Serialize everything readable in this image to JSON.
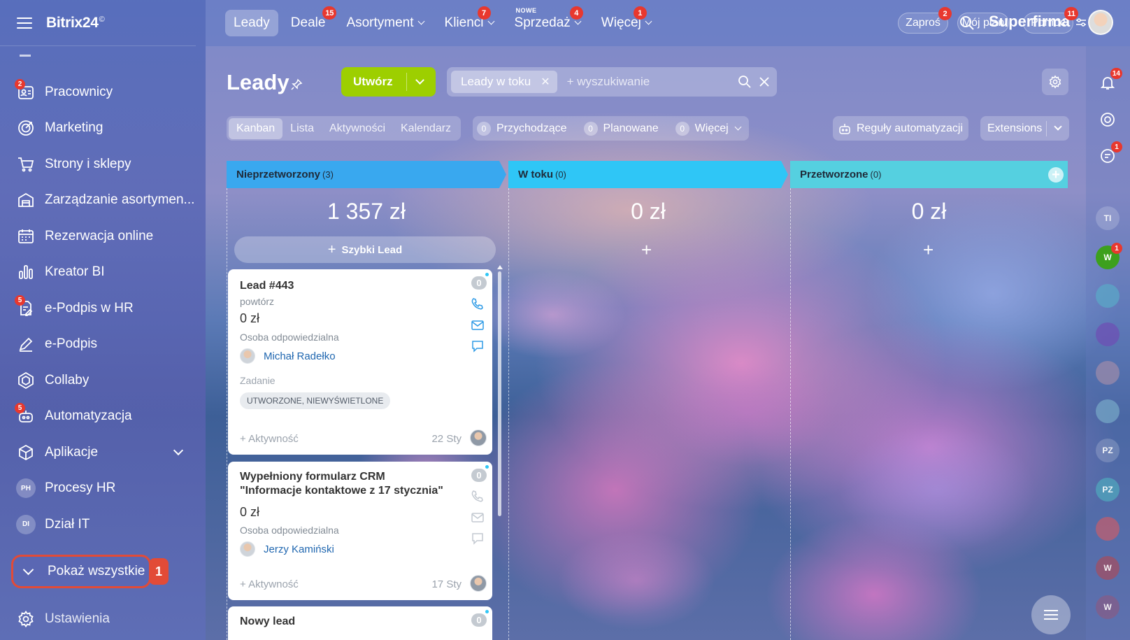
{
  "app": {
    "logo": "Bitrix24",
    "logo_mark": "©"
  },
  "sidebar": {
    "items": [
      {
        "label": "Pracownicy",
        "badge": "2",
        "icon": "employees-icon"
      },
      {
        "label": "Marketing",
        "badge": "",
        "icon": "marketing-icon"
      },
      {
        "label": "Strony i sklepy",
        "badge": "",
        "icon": "cart-icon"
      },
      {
        "label": "Zarządzanie asortymen...",
        "badge": "",
        "icon": "warehouse-icon"
      },
      {
        "label": "Rezerwacja online",
        "badge": "",
        "icon": "calendar-icon"
      },
      {
        "label": "Kreator BI",
        "badge": "",
        "icon": "bar-chart-icon"
      },
      {
        "label": "e-Podpis w HR",
        "badge": "5",
        "icon": "document-sign-icon"
      },
      {
        "label": "e-Podpis",
        "badge": "",
        "icon": "pen-icon"
      },
      {
        "label": "Collaby",
        "badge": "",
        "icon": "hexagon-icon"
      },
      {
        "label": "Automatyzacja",
        "badge": "5",
        "icon": "robot-icon"
      },
      {
        "label": "Aplikacje",
        "badge": "",
        "icon": "box-icon"
      },
      {
        "label": "Procesy HR",
        "avatar": "PH"
      },
      {
        "label": "Dział IT",
        "avatar": "DI"
      }
    ],
    "show_all": "Pokaż wszystkie",
    "callout": "1",
    "settings": "Ustawienia"
  },
  "topnav": {
    "items": [
      {
        "label": "Leady",
        "badge": "",
        "active": true
      },
      {
        "label": "Deale",
        "badge": "15"
      },
      {
        "label": "Asortyment",
        "badge": "",
        "dropdown": true
      },
      {
        "label": "Klienci",
        "badge": "7",
        "dropdown": true
      },
      {
        "label": "Sprzedaż",
        "badge": "4",
        "dropdown": true,
        "new_label": "NOWE"
      },
      {
        "label": "Więcej",
        "badge": "1",
        "dropdown": true
      }
    ],
    "company": "Superfirma",
    "invite": {
      "label": "Zaproś",
      "badge": "2"
    },
    "plan": "Mój plan",
    "help": {
      "label": "Pomoc",
      "badge": "11"
    }
  },
  "page": {
    "title": "Leady",
    "create": "Utwórz",
    "filter_chip": "Leady w toku",
    "search_placeholder": "+ wyszukiwanie",
    "views": [
      "Kanban",
      "Lista",
      "Aktywności",
      "Kalendarz"
    ],
    "counters": [
      {
        "count": "0",
        "label": "Przychodzące"
      },
      {
        "count": "0",
        "label": "Planowane"
      },
      {
        "count": "0",
        "label": "Więcej"
      }
    ],
    "automation_rules": "Reguły automatyzacji",
    "extensions": "Extensions"
  },
  "right_rail": {
    "notifications_badge": "14",
    "chat_badge": "1",
    "avatars": [
      "TI",
      "W",
      "PZ",
      "PZ",
      "W",
      "W"
    ],
    "w_badge": "1"
  },
  "kanban": {
    "columns": [
      {
        "name": "Nieprzetworzony",
        "count": "(3)",
        "sum": "1 357 zł",
        "color": "#39a8ef"
      },
      {
        "name": "W toku",
        "count": "(0)",
        "sum": "0 zł",
        "color": "#2fc6f6"
      },
      {
        "name": "Przetworzone",
        "count": "(0)",
        "sum": "0 zł",
        "color": "#55d0e0"
      }
    ],
    "quick_lead": "Szybki Lead",
    "cards": [
      {
        "title": "Lead #443",
        "subtitle": "powtórz",
        "amount": "0 zł",
        "responsible_label": "Osoba odpowiedzialna",
        "responsible": "Michał Radełko",
        "task_label": "Zadanie",
        "task_status": "UTWORZONE, NIEWYŚWIETLONE",
        "activity": "+ Aktywność",
        "date": "22 Sty",
        "counter": "0"
      },
      {
        "title": "Wypełniony formularz CRM \"Informacje kontaktowe z 17 stycznia\"",
        "amount": "0 zł",
        "responsible_label": "Osoba odpowiedzialna",
        "responsible": "Jerzy Kamiński",
        "activity": "+ Aktywność",
        "date": "17 Sty",
        "counter": "0"
      },
      {
        "title": "Nowy lead",
        "counter": "0"
      }
    ]
  }
}
